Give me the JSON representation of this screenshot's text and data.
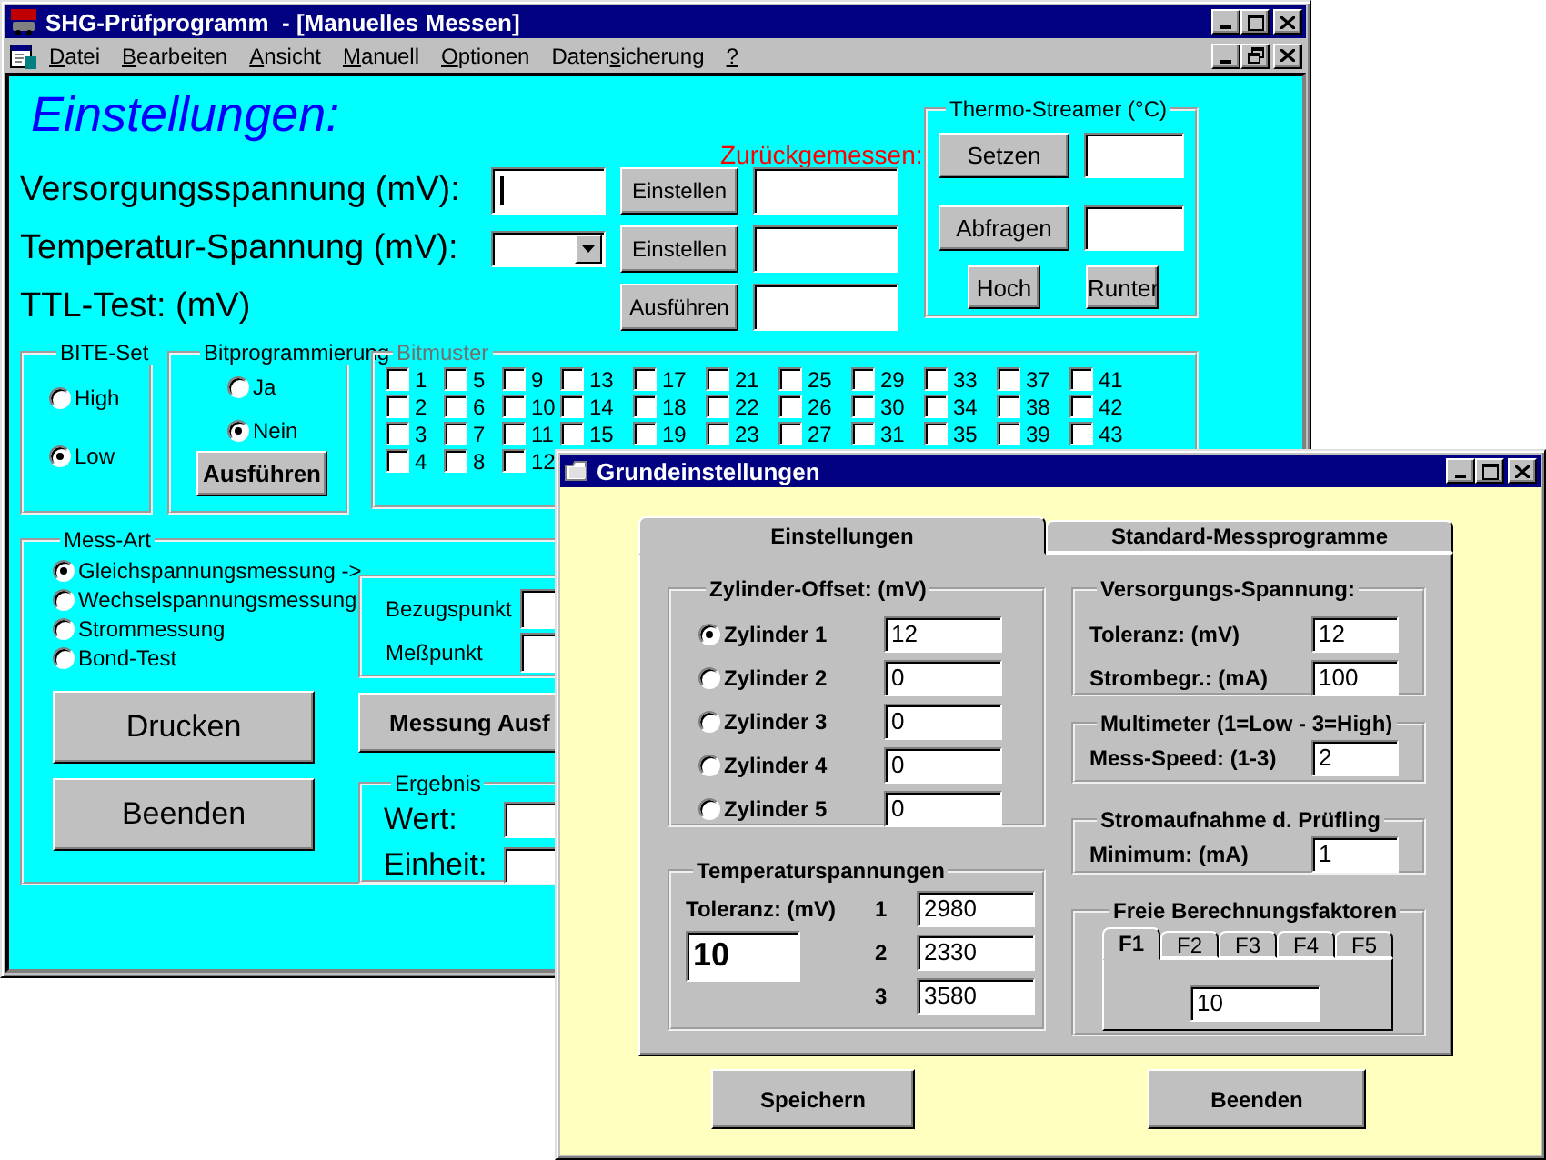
{
  "main_window": {
    "title": "SHG-Prüfprogramm  - [Manuelles Messen]",
    "menu": [
      {
        "accel": "D",
        "post": "atei"
      },
      {
        "accel": "B",
        "post": "earbeiten"
      },
      {
        "accel": "A",
        "post": "nsicht"
      },
      {
        "accel": "M",
        "post": "anuell"
      },
      {
        "accel": "O",
        "post": "ptionen"
      },
      {
        "pre": "Daten",
        "accel": "s",
        "post": "icherung"
      },
      {
        "accel": "?"
      }
    ],
    "heading": "Einstellungen:",
    "readback_label": "Zurückgemessen:",
    "settings_rows": [
      {
        "label": "Versorgungsspannung (mV):",
        "kind": "input",
        "focused": true,
        "button": "Einstellen"
      },
      {
        "label": "Temperatur-Spannung (mV):",
        "kind": "combo",
        "button": "Einstellen"
      },
      {
        "label": "TTL-Test: (mV)",
        "kind": "none",
        "button": "Ausführen"
      }
    ],
    "thermo_streamer": {
      "title": "Thermo-Streamer (°C)",
      "actions": [
        "Setzen",
        "Abfragen"
      ],
      "moves": [
        "Hoch",
        "Runter"
      ]
    },
    "bite_set": {
      "title": "BITE-Set",
      "options": [
        {
          "label": "High",
          "selected": false
        },
        {
          "label": "Low",
          "selected": true
        }
      ]
    },
    "bit_programming": {
      "title": "Bitprogrammierung",
      "options": [
        {
          "label": "Ja",
          "selected": false
        },
        {
          "label": "Nein",
          "selected": true
        }
      ],
      "button": "Ausführen"
    },
    "bit_pattern": {
      "title": "Bitmuster",
      "columns": [
        [
          {
            "label": "1",
            "checked": false
          },
          {
            "label": "2",
            "checked": false
          },
          {
            "label": "3",
            "checked": false
          },
          {
            "label": "4",
            "checked": false
          }
        ],
        [
          {
            "label": "5",
            "checked": false
          },
          {
            "label": "6",
            "checked": false
          },
          {
            "label": "7",
            "checked": false
          },
          {
            "label": "8",
            "checked": false
          }
        ],
        [
          {
            "label": "9",
            "checked": false
          },
          {
            "label": "10",
            "checked": false
          },
          {
            "label": "11",
            "checked": false
          },
          {
            "label": "12",
            "checked": false
          }
        ],
        [
          {
            "label": "13",
            "checked": false
          },
          {
            "label": "14",
            "checked": false
          },
          {
            "label": "15",
            "checked": false
          }
        ],
        [
          {
            "label": "17",
            "checked": false
          },
          {
            "label": "18",
            "checked": false
          },
          {
            "label": "19",
            "checked": false
          }
        ],
        [
          {
            "label": "21",
            "checked": false
          },
          {
            "label": "22",
            "checked": false
          },
          {
            "label": "23",
            "checked": false
          }
        ],
        [
          {
            "label": "25",
            "checked": false
          },
          {
            "label": "26",
            "checked": false
          },
          {
            "label": "27",
            "checked": false
          }
        ],
        [
          {
            "label": "29",
            "checked": false
          },
          {
            "label": "30",
            "checked": false
          },
          {
            "label": "31",
            "checked": false
          }
        ],
        [
          {
            "label": "33",
            "checked": false
          },
          {
            "label": "34",
            "checked": false
          },
          {
            "label": "35",
            "checked": false
          }
        ],
        [
          {
            "label": "37",
            "checked": false
          },
          {
            "label": "38",
            "checked": false
          },
          {
            "label": "39",
            "checked": false
          }
        ],
        [
          {
            "label": "41",
            "checked": false
          },
          {
            "label": "42",
            "checked": false
          },
          {
            "label": "43",
            "checked": false
          }
        ]
      ]
    },
    "measurement_type": {
      "title": "Mess-Art",
      "options": [
        {
          "label": "Gleichspannungsmessung ->",
          "selected": true
        },
        {
          "label": "Wechselspannungsmessung",
          "selected": false
        },
        {
          "label": "Strommessung",
          "selected": false
        },
        {
          "label": "Bond-Test",
          "selected": false
        }
      ],
      "print_button": "Drucken",
      "exit_button": "Beenden",
      "reference_label": "Bezugspunkt",
      "measure_point_label": "Meßpunkt",
      "measure_button": "Messung Ausf",
      "result": {
        "title": "Ergebnis",
        "value_label": "Wert:",
        "unit_label": "Einheit:"
      }
    }
  },
  "dialog": {
    "title": "Grundeinstellungen",
    "tabs": [
      {
        "label": "Einstellungen",
        "selected": true
      },
      {
        "label": "Standard-Messprogramme",
        "selected": false
      }
    ],
    "cylinder_offset": {
      "title": "Zylinder-Offset: (mV)",
      "cylinders": [
        {
          "label": "Zylinder 1",
          "selected": true,
          "value": "12"
        },
        {
          "label": "Zylinder 2",
          "selected": false,
          "value": "0"
        },
        {
          "label": "Zylinder 3",
          "selected": false,
          "value": "0"
        },
        {
          "label": "Zylinder 4",
          "selected": false,
          "value": "0"
        },
        {
          "label": "Zylinder 5",
          "selected": false,
          "value": "0"
        }
      ]
    },
    "temperature_voltages": {
      "title": "Temperaturspannungen",
      "tolerance_label": "Toleranz: (mV)",
      "tolerance": "10",
      "values": [
        {
          "index": "1",
          "value": "2980"
        },
        {
          "index": "2",
          "value": "2330"
        },
        {
          "index": "3",
          "value": "3580"
        }
      ]
    },
    "supply_voltage": {
      "title": "Versorgungs-Spannung:",
      "fields": [
        {
          "label": "Toleranz: (mV)",
          "value": "12"
        },
        {
          "label": "Strombegr.: (mA)",
          "value": "100"
        }
      ]
    },
    "multimeter": {
      "title": "Multimeter (1=Low - 3=High)",
      "fields": [
        {
          "label": "Mess-Speed: (1-3)",
          "value": "2"
        }
      ]
    },
    "current_draw": {
      "title": "Stromaufnahme d. Prüfling",
      "fields": [
        {
          "label": "Minimum: (mA)",
          "value": "1"
        }
      ]
    },
    "factors": {
      "title": "Freie Berechnungsfaktoren",
      "tabs": [
        {
          "label": "F1",
          "selected": true
        },
        {
          "label": "F2",
          "selected": false
        },
        {
          "label": "F3",
          "selected": false
        },
        {
          "label": "F4",
          "selected": false
        },
        {
          "label": "F5",
          "selected": false
        }
      ],
      "value": "10"
    },
    "buttons": [
      "Speichern",
      "Beenden"
    ]
  }
}
